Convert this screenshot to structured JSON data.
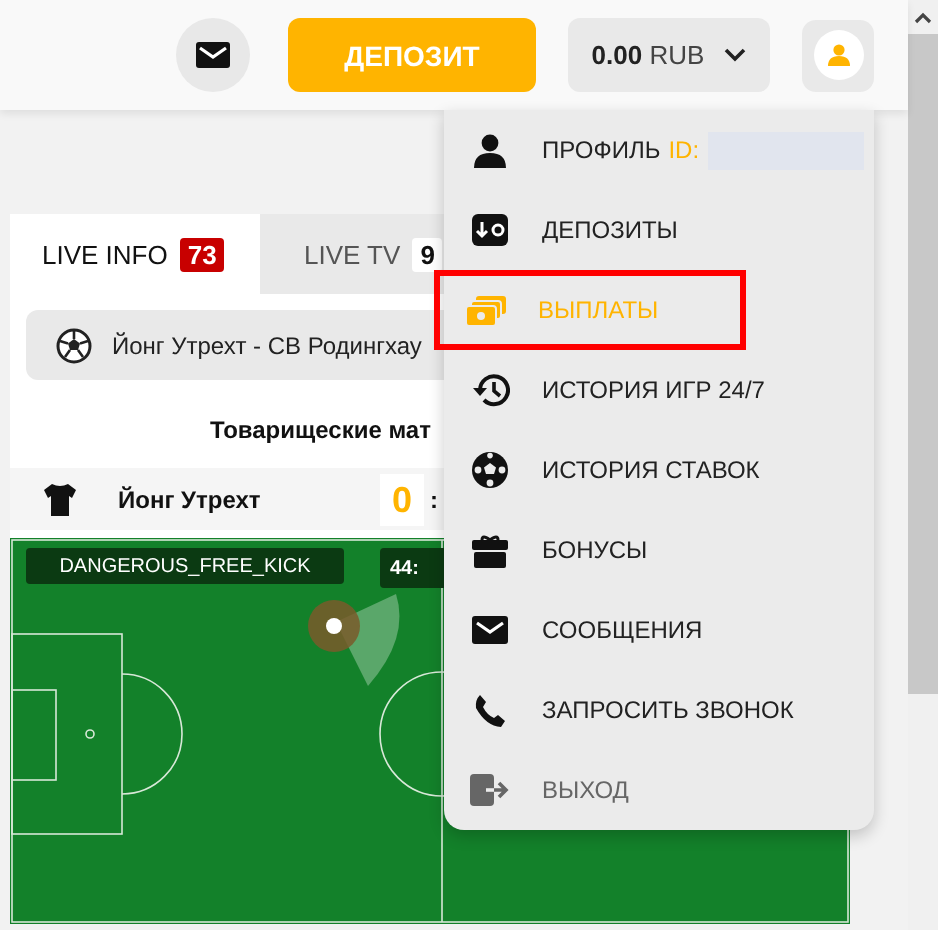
{
  "header": {
    "deposit_button": "ДЕПОЗИТ",
    "balance": {
      "amount": "0.00",
      "currency": "RUB"
    }
  },
  "tabs": [
    {
      "label": "LIVE INFO",
      "count": "73",
      "selected": true
    },
    {
      "label": "LIVE TV",
      "count": "9",
      "selected": false
    }
  ],
  "match": {
    "title": "Йонг Утрехт - СВ Родингхау",
    "tournament": "Товарищеские мат",
    "home_team": "Йонг Утрехт",
    "home_score": "0",
    "separator": ":",
    "event": "DANGEROUS_FREE_KICK",
    "clock": "44:"
  },
  "user_menu": {
    "items": [
      {
        "kind": "profile",
        "label": "ПРОФИЛЬ",
        "id_label": "ID:",
        "selected": false,
        "highlighted": false
      },
      {
        "kind": "deposits",
        "label": "ДЕПОЗИТЫ",
        "selected": false,
        "highlighted": false
      },
      {
        "kind": "payouts",
        "label": "ВЫПЛАТЫ",
        "selected": true,
        "highlighted": true
      },
      {
        "kind": "games",
        "label": "ИСТОРИЯ ИГР 24/7",
        "selected": false,
        "highlighted": false
      },
      {
        "kind": "bets",
        "label": "ИСТОРИЯ СТАВОК",
        "selected": false,
        "highlighted": false
      },
      {
        "kind": "bonuses",
        "label": "БОНУСЫ",
        "selected": false,
        "highlighted": false
      },
      {
        "kind": "messages",
        "label": "СООБЩЕНИЯ",
        "selected": false,
        "highlighted": false
      },
      {
        "kind": "callback",
        "label": "ЗАПРОСИТЬ ЗВОНОК",
        "selected": false,
        "highlighted": false
      },
      {
        "kind": "logout",
        "label": "ВЫХОД",
        "selected": false,
        "highlighted": false
      }
    ]
  }
}
